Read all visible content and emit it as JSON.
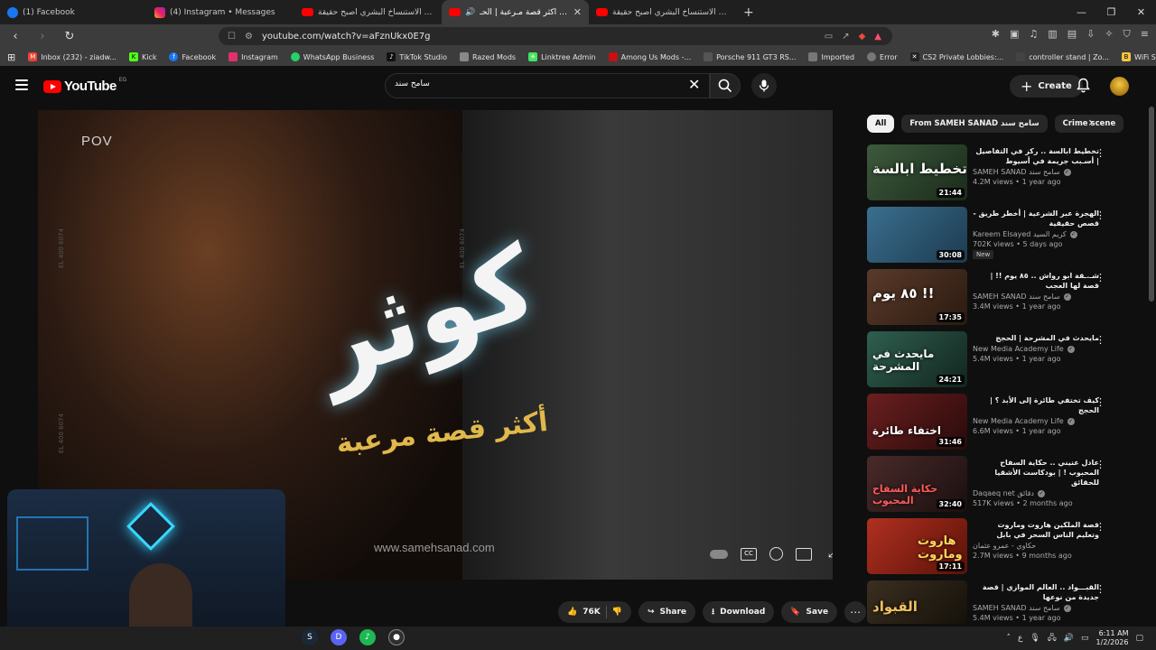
{
  "browser": {
    "tabs": [
      {
        "title": "(1) Facebook",
        "icon": "facebook-icon"
      },
      {
        "title": "(4) Instagram • Messages",
        "icon": "instagram-icon"
      },
      {
        "title": "رعب الاستنساخ البشري اصبح حقيقة !! | ...",
        "icon": "youtube-icon"
      },
      {
        "title": "كوثر .. أكثر قصة مـرعبة | الحـ...",
        "icon": "youtube-icon",
        "active": true
      },
      {
        "title": "رعب الاستنساخ البشري اصبح حقيقة !! | ...",
        "icon": "youtube-icon"
      }
    ],
    "new_tab": "+",
    "url": "youtube.com/watch?v=aFznUkx0E7g",
    "bookmarks": [
      {
        "label": "Inbox (232) - ziadw...",
        "icon": "gmail-icon",
        "color": "#ea4335"
      },
      {
        "label": "Kick",
        "icon": "kick-icon",
        "color": "#53fc18"
      },
      {
        "label": "Facebook",
        "icon": "facebook-icon",
        "color": "#1877f2"
      },
      {
        "label": "Instagram",
        "icon": "instagram-icon",
        "color": "#e1306c"
      },
      {
        "label": "WhatsApp Business",
        "icon": "whatsapp-icon",
        "color": "#25d366"
      },
      {
        "label": "TikTok Studio",
        "icon": "tiktok-icon",
        "color": "#111111"
      },
      {
        "label": "Razed Mods",
        "icon": "razed-icon",
        "color": "#888888"
      },
      {
        "label": "Linktree Admin",
        "icon": "linktree-icon",
        "color": "#43e55e"
      },
      {
        "label": "Among Us Mods -...",
        "icon": "among-us-icon",
        "color": "#c51111"
      },
      {
        "label": "Porsche 911 GT3 RS...",
        "icon": "porsche-icon",
        "color": "#555555"
      },
      {
        "label": "Imported",
        "icon": "folder-icon",
        "color": "#777777"
      },
      {
        "label": "Error",
        "icon": "globe-icon",
        "color": "#777777"
      },
      {
        "label": "CS2 Private Lobbies:...",
        "icon": "cs2-icon",
        "color": "#222222"
      },
      {
        "label": "controller stand | Zo...",
        "icon": "zo-icon",
        "color": "#444444"
      },
      {
        "label": "WiFi Smart Wall Lig...",
        "icon": "wifi-icon",
        "color": "#f5c542"
      }
    ]
  },
  "youtube": {
    "logo": "YouTube",
    "country": "EG",
    "search_value": "سامح سند",
    "create_label": "Create",
    "accent": "#ff0000"
  },
  "video": {
    "pov_label": "POV",
    "title_art": "كوثر",
    "subtitle_art": "أكثر قصة مرعبة",
    "watermark": "www.samehsanad.com",
    "side_code": "EL 400 6074"
  },
  "actions": {
    "likes": "76K",
    "share": "Share",
    "download": "Download",
    "save": "Save"
  },
  "chips": [
    "All",
    "From SAMEH SANAD سامح سند",
    "Crime scene"
  ],
  "recommendations": [
    {
      "title": "تخطيط ابالسة .. ركز في التفاصيل | أسـبب جريمة في أسيوط",
      "channel": "SAMEH SANAD سامح سند",
      "views": "4.2M views • 1 year ago",
      "duration": "21:44",
      "thumb_text": "تخطيط ابالسة",
      "thumb_color": "#3d5a3d"
    },
    {
      "title": "الهجرة عبر الشرعية | أخطر طريق - قصص حقيقية",
      "channel": "Kareem Elsayed كريم السيد",
      "views": "702K views • 5 days ago",
      "badge": "New",
      "duration": "30:08",
      "thumb_text": "",
      "thumb_color": "#3a6f8f"
    },
    {
      "title": "شـ.ـقة ابو رواش .. ٨٥ يوم !! | قصة لها العجب",
      "channel": "SAMEH SANAD سامح سند",
      "views": "3.4M views • 1 year ago",
      "duration": "17:35",
      "thumb_text": "٨٥ يوم !!",
      "thumb_color": "#5a3a2a"
    },
    {
      "title": "مايحدث في المشرحة | الحجج",
      "channel": "New Media Academy Life",
      "views": "5.4M views • 1 year ago",
      "duration": "24:21",
      "thumb_text": "مايحدث في المشرحة",
      "thumb_color": "#2f5f4f"
    },
    {
      "title": "كيف تختفي طائرة إلى الأبد ؟ | الحجج",
      "channel": "New Media Academy Life",
      "views": "6.6M views • 1 year ago",
      "duration": "31:46",
      "thumb_text": "اختفاء طائرة",
      "thumb_color": "#6a1f1f"
    },
    {
      "title": "عادل عنيني .. حكاية السفاح المحبوب ! | بودكاست الأشقيا للحقائق",
      "channel": "Daqaeq net دقائق",
      "views": "517K views • 2 months ago",
      "duration": "32:40",
      "thumb_text": "حكاية السفاح المحبوب",
      "thumb_color": "#4a2a2a"
    },
    {
      "title": "قصة الملكين هاروت وماروت وتعليم الناس السحر في بابل",
      "channel": "حكاوي - عمرو عثمان",
      "views": "2.7M views • 9 months ago",
      "duration": "17:11",
      "thumb_text": "هاروت وماروت",
      "thumb_color": "#b03020"
    },
    {
      "title": "القبـــواد .. العالم الموازي | قصة جديدة من نوعها",
      "channel": "SAMEH SANAD سامح سند",
      "views": "5.4M views • 1 year ago",
      "duration": "",
      "thumb_text": "القبواد",
      "thumb_color": "#3a2f20"
    }
  ],
  "taskbar": {
    "time": "6:11 AM",
    "date": "1/2/2026",
    "lang": "ع"
  }
}
